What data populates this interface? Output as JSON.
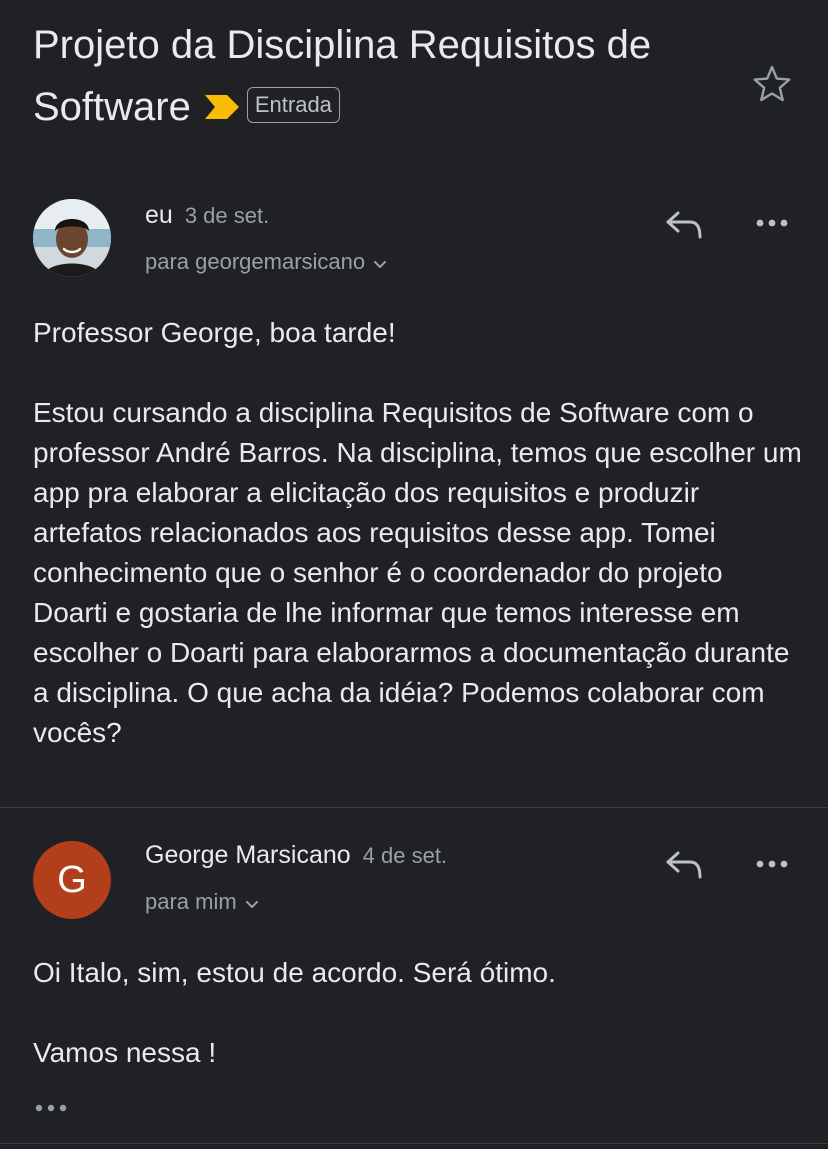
{
  "subject": {
    "line1": "Projeto da Disciplina Requisitos de",
    "line2": "Software",
    "label": "Entrada",
    "importance_icon": "importance-marker-icon",
    "importance_color": "#fbbc04"
  },
  "icons": {
    "star": "star-outline-icon",
    "reply": "reply-arrow-icon",
    "more": "more-horizontal-icon",
    "chevron": "chevron-down-icon"
  },
  "messages": [
    {
      "sender": "eu",
      "date": "3 de set.",
      "recipient": "para georgemarsicano",
      "avatar": "photo",
      "body": [
        "Professor George, boa tarde!",
        "Estou cursando a disciplina Requisitos de Software com o professor André Barros. Na disciplina, temos que escolher um app pra elaborar a elicitação dos requisitos e produzir artefatos relacionados aos requisitos desse app. Tomei conhecimento que o senhor é o coordenador do projeto Doarti e gostaria de lhe informar que temos interesse em escolher o Doarti para elaborarmos a documentação durante a disciplina. O que acha da idéia? Podemos colaborar com vocês?"
      ]
    },
    {
      "sender": "George Marsicano",
      "date": "4 de set.",
      "recipient": "para mim",
      "avatar_letter": "G",
      "avatar_color": "#b23e1c",
      "body": [
        "Oi Italo, sim, estou de acordo. Será ótimo.",
        "Vamos nessa !"
      ]
    }
  ],
  "colors": {
    "background": "#202124",
    "text": "#e8eaed",
    "muted": "#9aa0a6"
  }
}
